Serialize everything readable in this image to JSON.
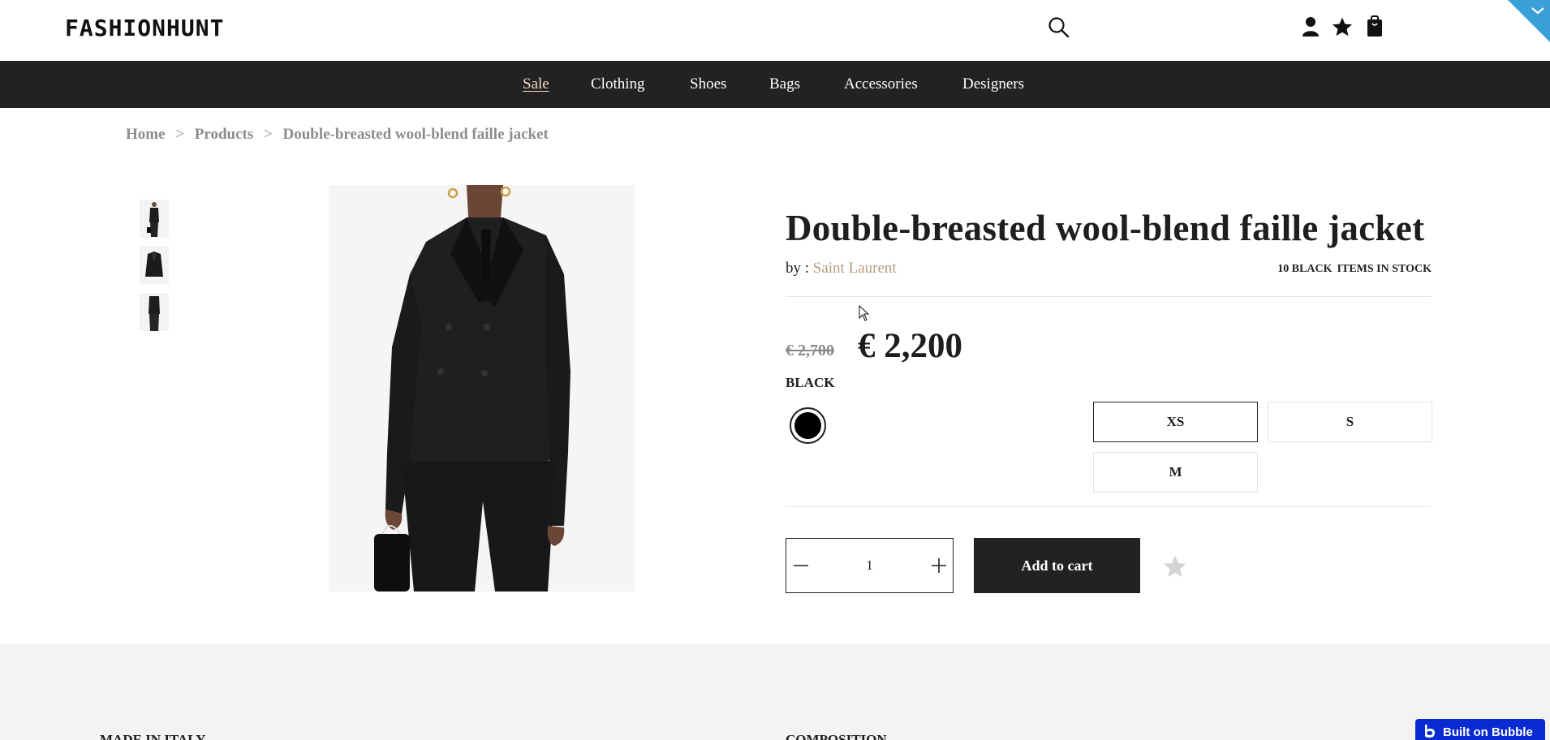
{
  "header": {
    "logo": "FASHIONHUNT",
    "icons": [
      "search-icon",
      "user-icon",
      "star-icon",
      "shopping-bag-icon",
      "chevron-down-icon"
    ]
  },
  "nav": {
    "items": [
      {
        "label": "Sale",
        "active": true
      },
      {
        "label": "Clothing"
      },
      {
        "label": "Shoes"
      },
      {
        "label": "Bags"
      },
      {
        "label": "Accessories"
      },
      {
        "label": "Designers"
      }
    ]
  },
  "breadcrumb": {
    "home": "Home",
    "products": "Products",
    "current": "Double-breasted wool-blend faille jacket",
    "separator": ">"
  },
  "product": {
    "title": "Double-breasted wool-blend faille jacket",
    "by_label": "by :",
    "brand": "Saint Laurent",
    "stock_color": "10 BLACK",
    "stock_text": "ITEMS IN STOCK",
    "old_price": "€ 2,700",
    "price": "€ 2,200",
    "color_label": "BLACK",
    "swatch_color": "#000000",
    "sizes": [
      {
        "label": "XS",
        "selected": true
      },
      {
        "label": "S",
        "selected": false
      },
      {
        "label": "M",
        "selected": false
      }
    ],
    "quantity": "1",
    "add_to_cart": "Add to cart"
  },
  "details": {
    "made_in": "MADE IN ITALY",
    "composition": "COMPOSITION"
  },
  "badge": {
    "label": "Built on Bubble"
  },
  "colors": {
    "nav_bg": "#222222",
    "sale_link": "#f2dcc8",
    "brand_link": "#b59e7e",
    "button_bg": "#222222",
    "ribbon": "#3aa0d8",
    "badge_bg": "#0a2bd1"
  }
}
